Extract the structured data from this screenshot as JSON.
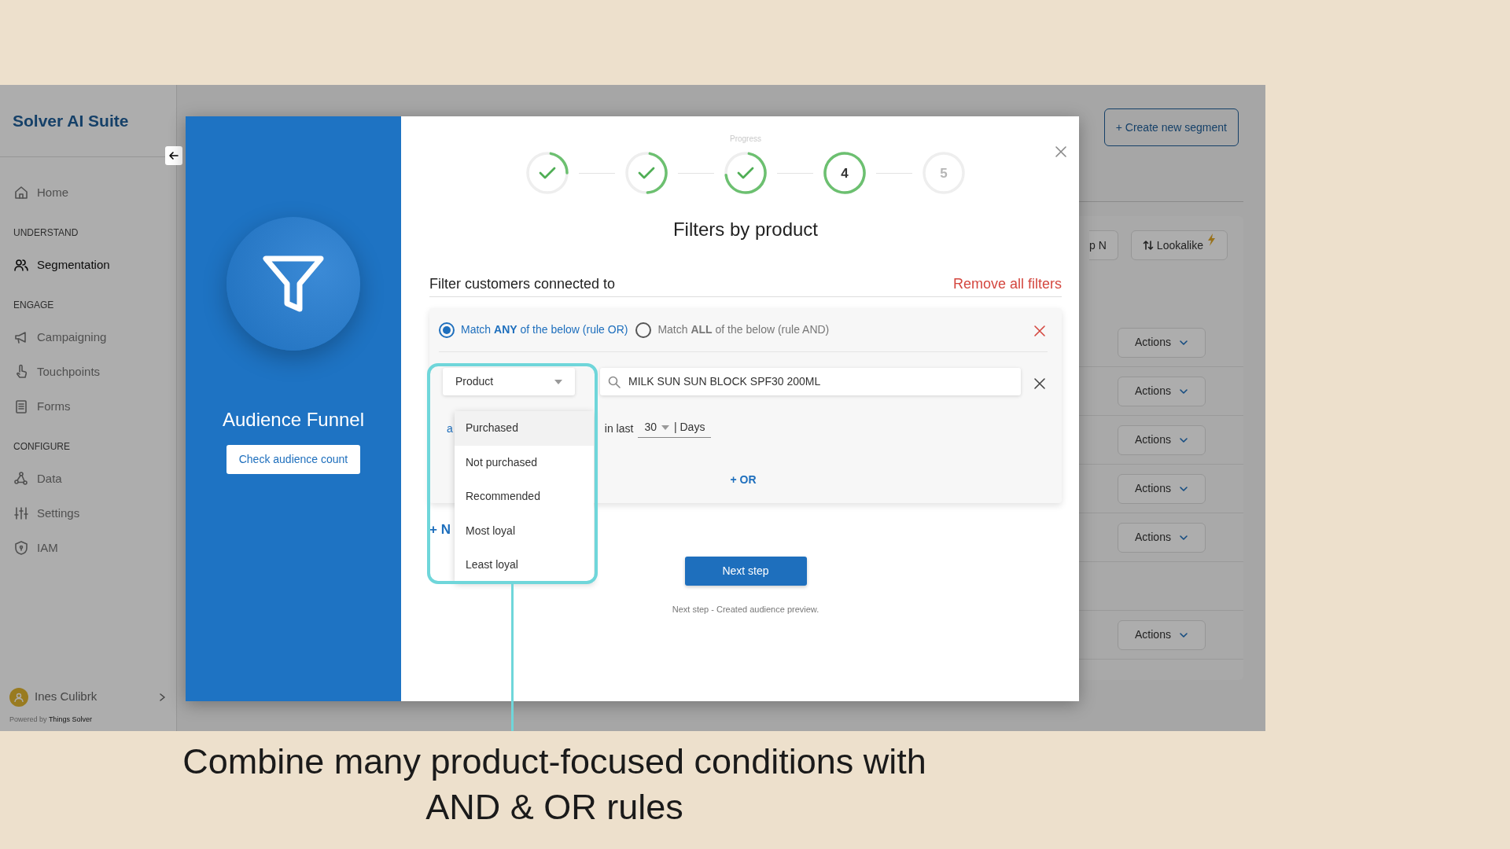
{
  "sidebar": {
    "brand": "Solver AI Suite",
    "sections": [
      {
        "items": [
          {
            "label": "Home",
            "selected": false
          }
        ]
      },
      {
        "heading": "UNDERSTAND",
        "items": [
          {
            "label": "Segmentation",
            "selected": true
          }
        ]
      },
      {
        "heading": "ENGAGE",
        "items": [
          {
            "label": "Campaigning",
            "selected": false
          },
          {
            "label": "Touchpoints",
            "selected": false
          },
          {
            "label": "Forms",
            "selected": false
          }
        ]
      },
      {
        "heading": "CONFIGURE",
        "items": [
          {
            "label": "Data",
            "selected": false
          },
          {
            "label": "Settings",
            "selected": false
          },
          {
            "label": "IAM",
            "selected": false
          }
        ]
      }
    ],
    "user": {
      "name": "Ines Culibrk"
    },
    "footer": {
      "prefix": "Powered by",
      "brand": "Things Solver"
    }
  },
  "background": {
    "create_button": "+ Create new segment",
    "toolbar": [
      "p N",
      "Lookalike"
    ],
    "rows": [
      {
        "kind": "action",
        "action": "Actions"
      },
      {
        "kind": "action",
        "action": "Actions"
      },
      {
        "kind": "action",
        "action": "Actions"
      },
      {
        "kind": "action",
        "action": "Actions"
      },
      {
        "kind": "action",
        "action": "Actions"
      },
      {
        "kind": "blank"
      },
      {
        "kind": "action",
        "action": "Actions"
      }
    ]
  },
  "modal": {
    "side": {
      "title": "Audience Funnel",
      "button": "Check audience count"
    },
    "progress_label": "Progress",
    "steps": [
      {
        "completed": true,
        "current": false
      },
      {
        "completed": true,
        "current": false
      },
      {
        "completed": true,
        "current": false
      },
      {
        "completed": false,
        "current": true,
        "label": "4"
      },
      {
        "completed": false,
        "current": false,
        "label": "5"
      }
    ],
    "title": "Filters by product",
    "section_label": "Filter customers connected to",
    "remove_all": "Remove all filters",
    "filter_group": {
      "rules": [
        {
          "text": "Match **ANY** of the below (rule OR)",
          "selected": true
        },
        {
          "text": "Match **ALL** of the below (rule AND)",
          "selected": false
        }
      ],
      "condition": {
        "type_select": "Product",
        "search_value": "MILK SUN SUN BLOCK SPF30 200ML",
        "cut_label": "a",
        "in_last": "in last",
        "period_value": "30",
        "period_unit": "| Days"
      },
      "add_or": "+ OR"
    },
    "dropdown": {
      "items": [
        {
          "label": "Purchased",
          "selected": true
        },
        {
          "label": "Not purchased",
          "selected": false
        },
        {
          "label": "Recommended",
          "selected": false
        },
        {
          "label": "Most loyal",
          "selected": false
        },
        {
          "label": "Least loyal",
          "selected": false
        }
      ]
    },
    "add_cut": "+ N",
    "next_button": "Next step",
    "hint": "Next step - Created audience preview."
  },
  "caption": [
    "Combine many product-focused conditions with",
    "AND & OR rules"
  ]
}
